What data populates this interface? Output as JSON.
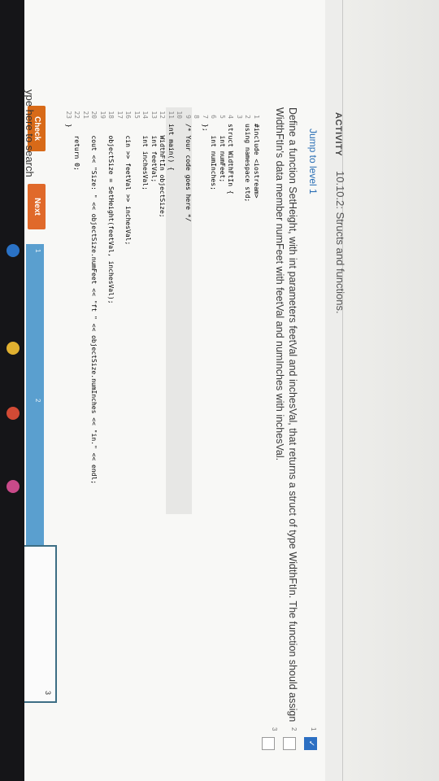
{
  "header": {
    "activity": "ACTIVITY",
    "section": "10.10.2: Structs and functions."
  },
  "main": {
    "jump_link": "Jump to level 1",
    "prompt": "Define a function SetHeight, with int parameters feetVal and inchesVal, that returns a struct of type WidthFtIn. The function should assign WidthFtIn's data member numFeet with feetVal and numInches with inchesVal.",
    "levels": [
      "1",
      "2",
      "3"
    ],
    "code_lines": [
      {
        "n": "1",
        "t": "#include <iostream>"
      },
      {
        "n": "2",
        "t": "using namespace std;"
      },
      {
        "n": "3",
        "t": ""
      },
      {
        "n": "4",
        "t": "struct WidthFtIn {"
      },
      {
        "n": "5",
        "t": "   int numFeet;"
      },
      {
        "n": "6",
        "t": "   int numInches;"
      },
      {
        "n": "7",
        "t": "};"
      },
      {
        "n": "8",
        "t": ""
      },
      {
        "n": "9",
        "t": "/* Your code goes here */"
      },
      {
        "n": "10",
        "t": ""
      },
      {
        "n": "11",
        "t": "int main() {"
      },
      {
        "n": "12",
        "t": "   WidthFtIn objectSize;"
      },
      {
        "n": "13",
        "t": "   int feetVal;"
      },
      {
        "n": "14",
        "t": "   int inchesVal;"
      },
      {
        "n": "15",
        "t": ""
      },
      {
        "n": "16",
        "t": "   cin >> feetVal >> inchesVal;"
      },
      {
        "n": "17",
        "t": ""
      },
      {
        "n": "18",
        "t": "   objectSize = SetHeight(feetVal, inchesVal);"
      },
      {
        "n": "19",
        "t": ""
      },
      {
        "n": "20",
        "t": "   cout << \"Size: \" << objectSize.numFeet << \"ft \" << objectSize.numInches << \"in.\" << endl;"
      },
      {
        "n": "21",
        "t": ""
      },
      {
        "n": "22",
        "t": "   return 0;"
      },
      {
        "n": "23",
        "t": "}"
      }
    ],
    "check_label": "Check",
    "next_label": "Next",
    "progress_segments": [
      "1",
      "2"
    ],
    "answer_value": "3"
  },
  "taskbar": {
    "search_text": "ype here to search"
  },
  "colors": {
    "check": "#d86a18",
    "next": "#e0692a",
    "progress": "#5a9fcf",
    "link": "#2b6fb5"
  }
}
